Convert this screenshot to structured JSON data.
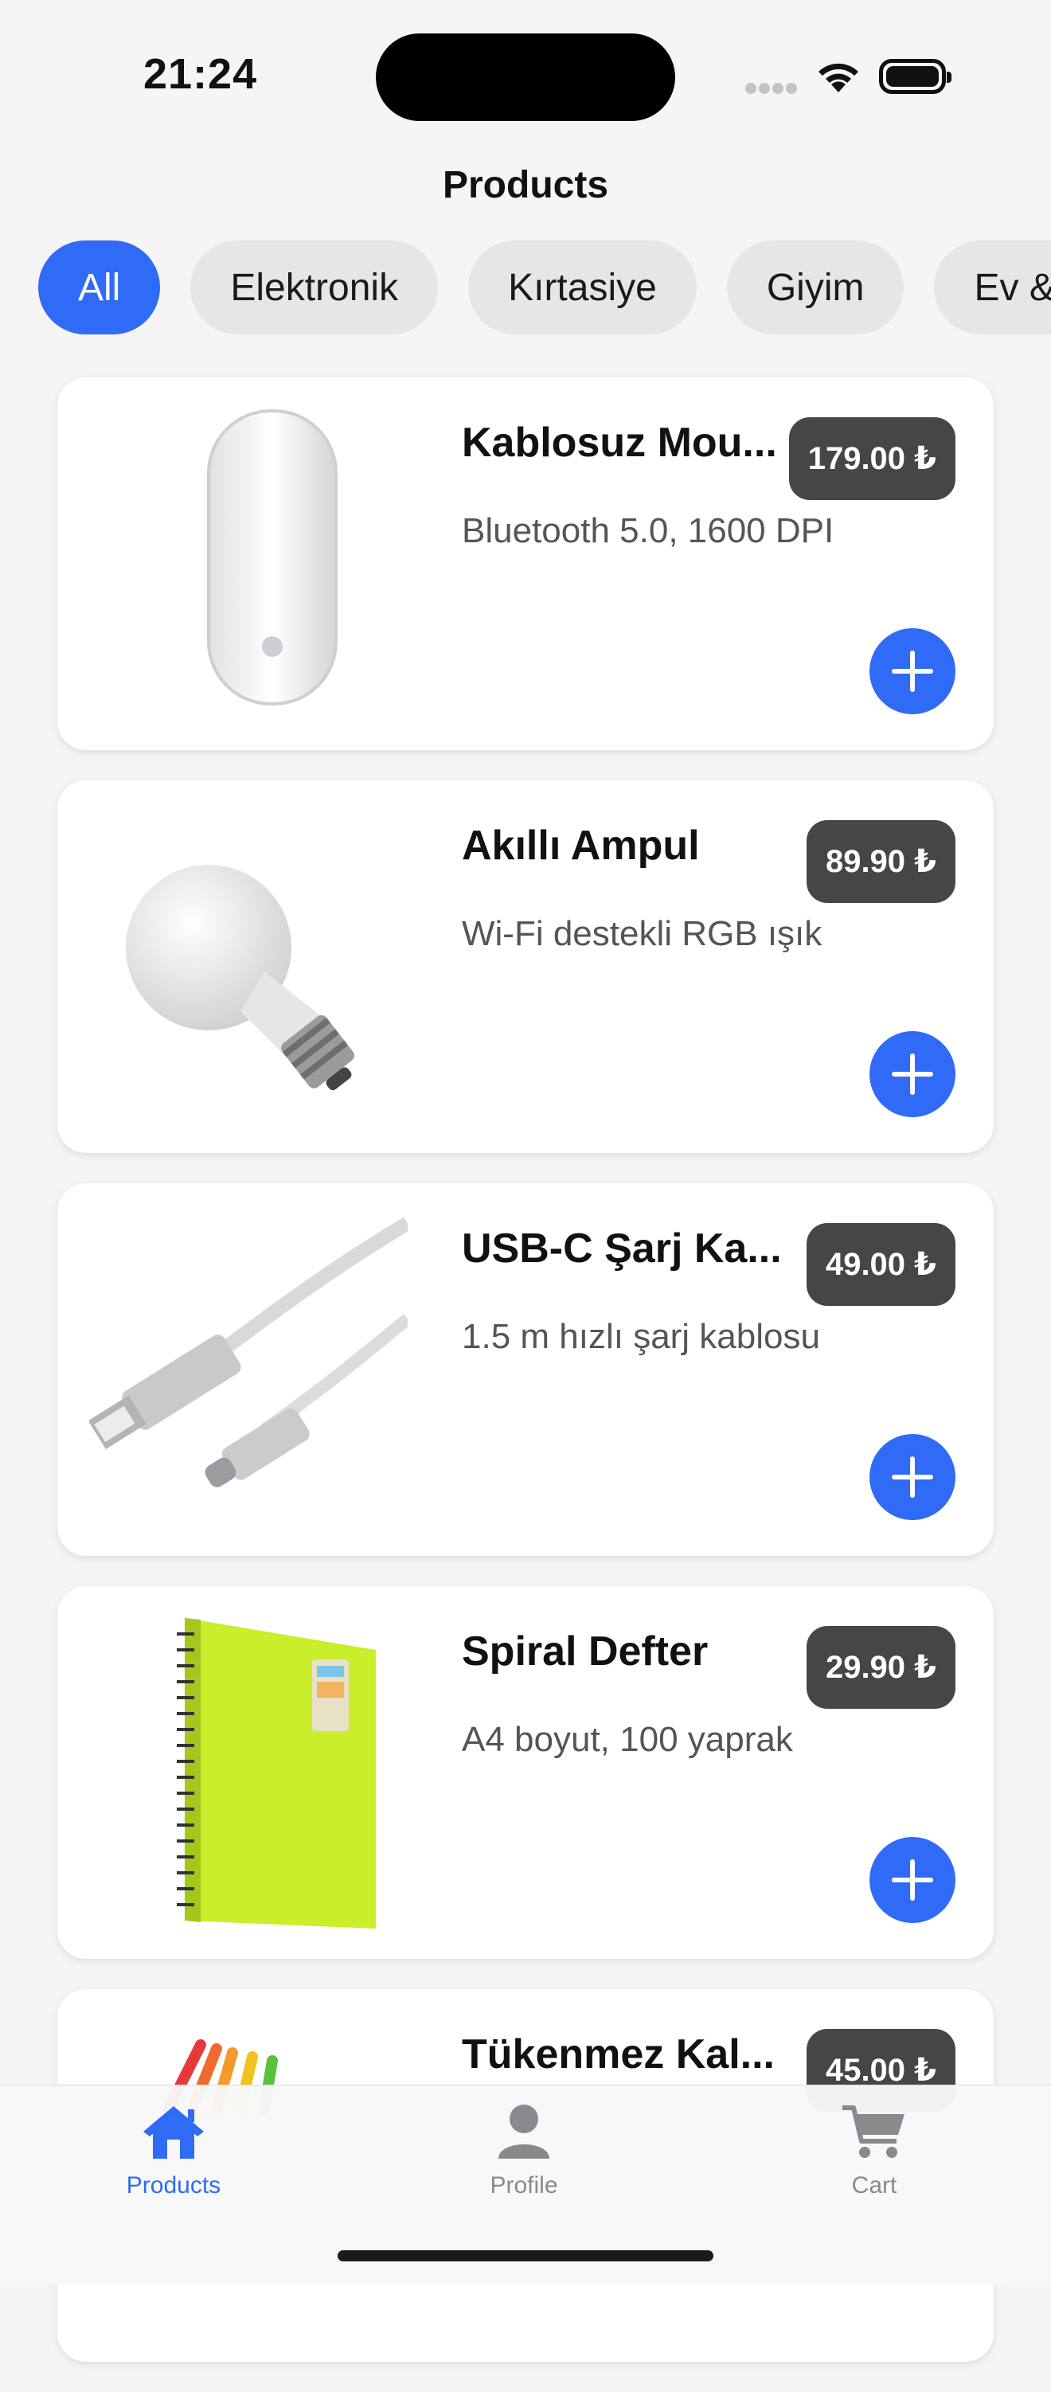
{
  "status_bar": {
    "time": "21:24"
  },
  "header": {
    "title": "Products"
  },
  "categories": [
    {
      "label": "All",
      "active": true
    },
    {
      "label": "Elektronik",
      "active": false
    },
    {
      "label": "Kırtasiye",
      "active": false
    },
    {
      "label": "Giyim",
      "active": false
    },
    {
      "label": "Ev &",
      "active": false
    }
  ],
  "products": [
    {
      "name": "Kablosuz Mou...",
      "description": "Bluetooth 5.0, 1600 DPI",
      "price": "179.00 ₺",
      "image_icon": "magic-mouse"
    },
    {
      "name": "Akıllı Ampul",
      "description": "Wi-Fi destekli RGB ışık",
      "price": "89.90 ₺",
      "image_icon": "light-bulb"
    },
    {
      "name": "USB-C Şarj Ka...",
      "description": "1.5 m hızlı şarj kablosu",
      "price": "49.00 ₺",
      "image_icon": "usb-cable"
    },
    {
      "name": "Spiral Defter",
      "description": "A4 boyut, 100 yaprak",
      "price": "29.90 ₺",
      "image_icon": "notebook"
    },
    {
      "name": "Tükenmez Kal...",
      "description": "",
      "price": "45.00 ₺",
      "image_icon": "pens"
    }
  ],
  "tab_bar": {
    "tabs": [
      {
        "label": "Products",
        "icon": "house-icon",
        "active": true
      },
      {
        "label": "Profile",
        "icon": "person-icon",
        "active": false
      },
      {
        "label": "Cart",
        "icon": "cart-icon",
        "active": false
      }
    ]
  },
  "colors": {
    "accent": "#2f6bf6",
    "price_badge": "#464646",
    "background": "#f5f5f6"
  }
}
